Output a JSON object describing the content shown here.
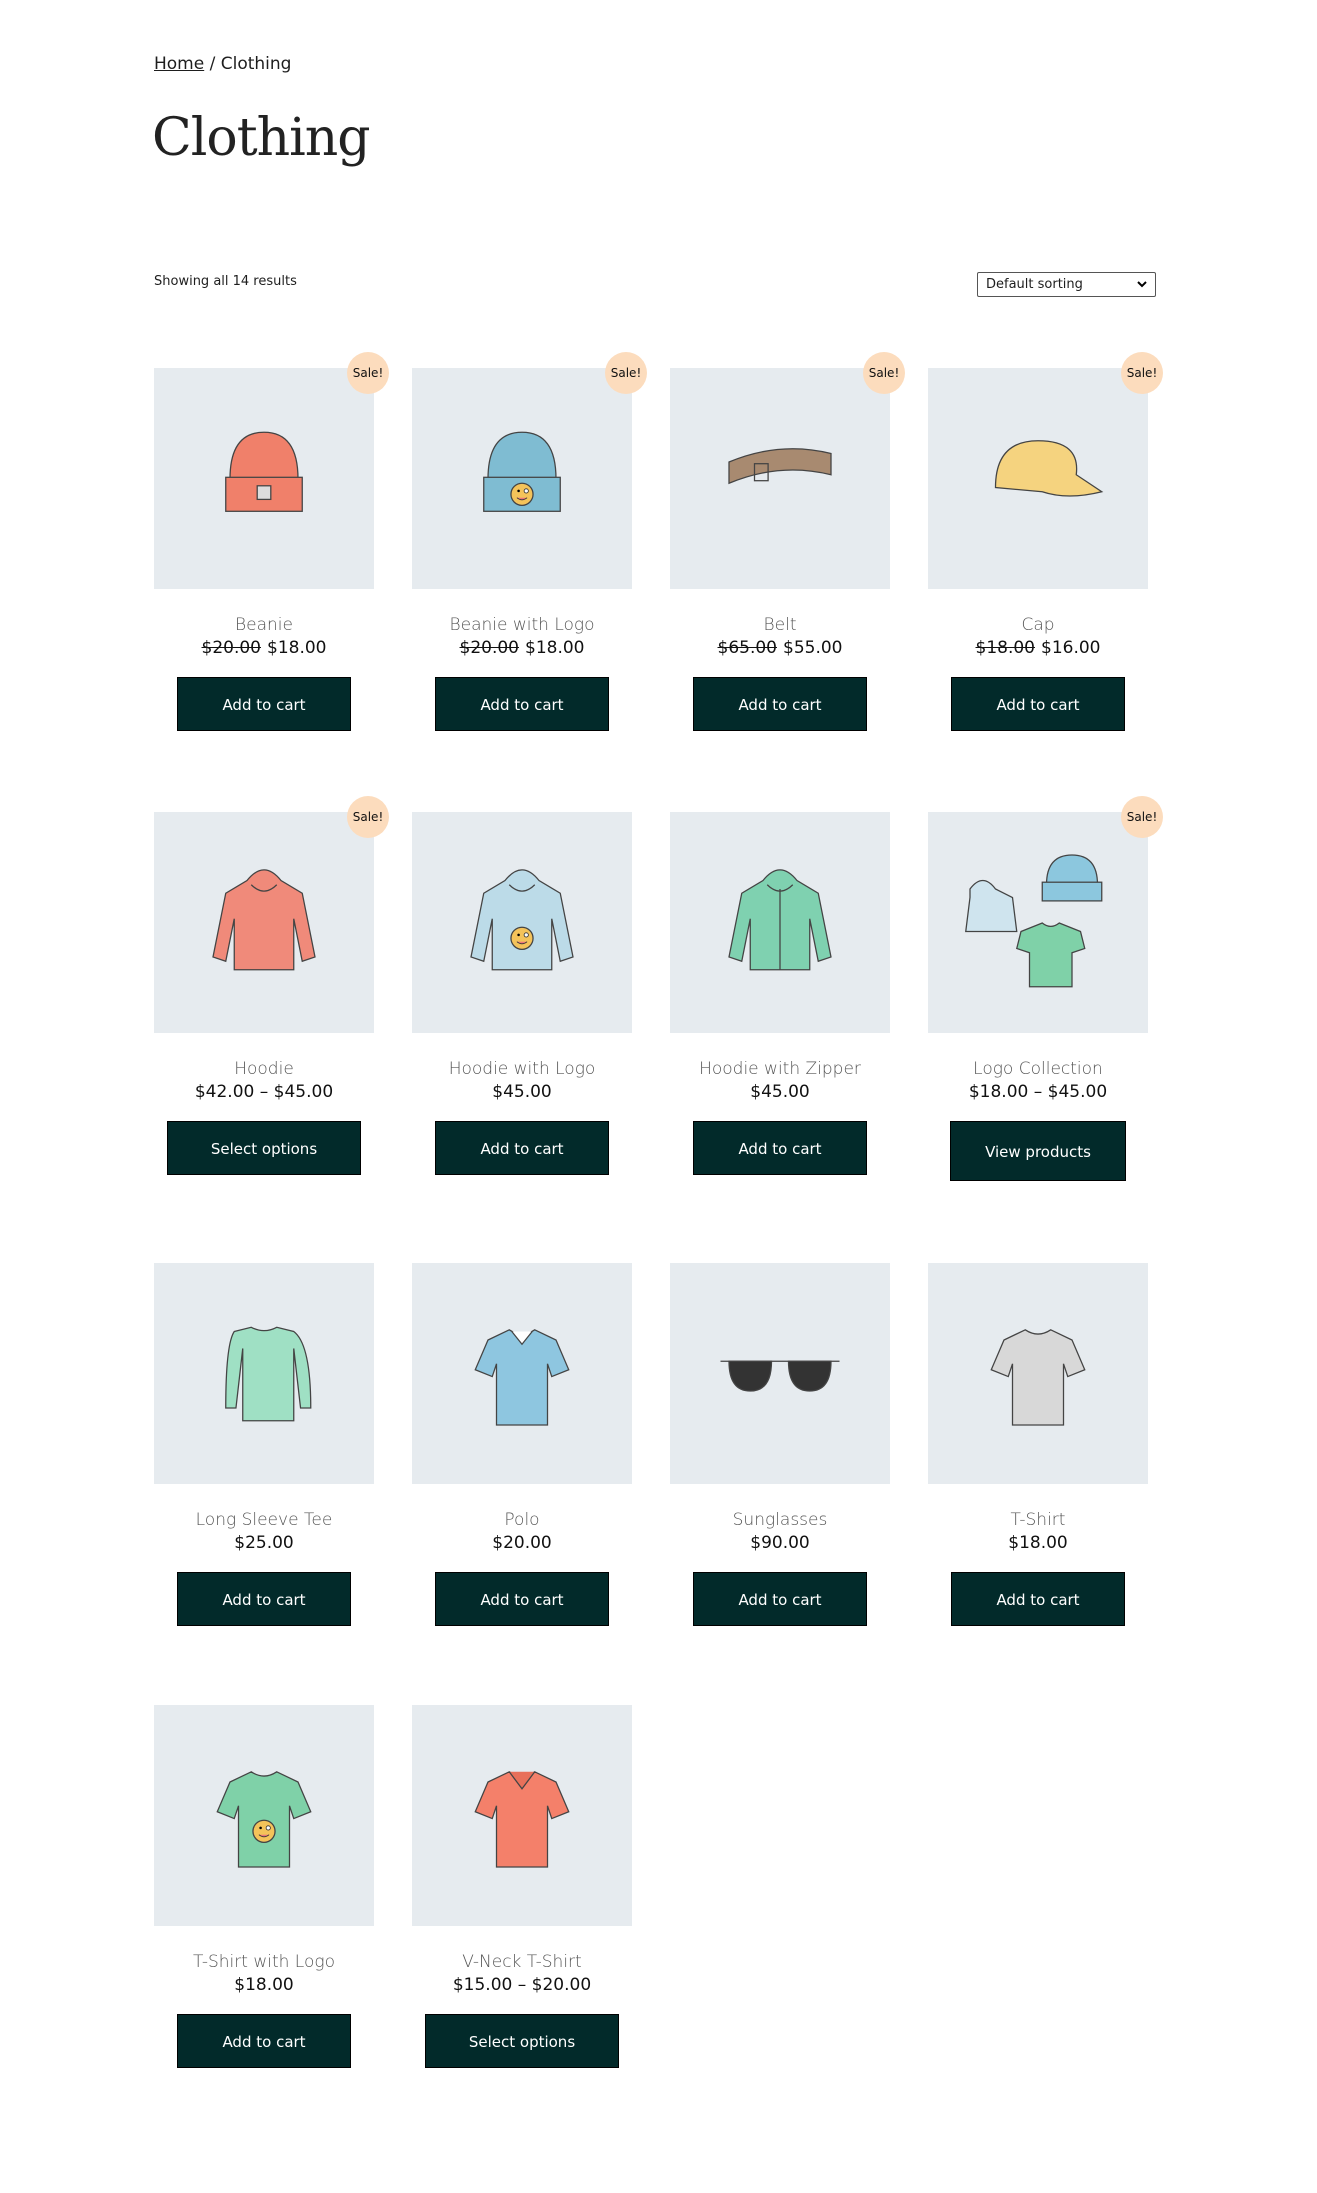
{
  "breadcrumb": {
    "home": "Home",
    "separator": " / ",
    "current": "Clothing"
  },
  "page_title": "Clothing",
  "result_count": "Showing all 14 results",
  "sorting": {
    "selected": "Default sorting",
    "icon": "chevron-down-icon"
  },
  "sale_label": "Sale!",
  "colors": {
    "button": "#022a2a",
    "badge": "#fcdcbd",
    "image_bg": "#e6ebef"
  },
  "products": [
    {
      "name": "Beanie",
      "regular_price": "$20.00",
      "price": "$18.00",
      "sale": true,
      "button": "Add to cart",
      "kind": "beanie",
      "color": "#f0806a"
    },
    {
      "name": "Beanie with Logo",
      "regular_price": "$20.00",
      "price": "$18.00",
      "sale": true,
      "button": "Add to cart",
      "kind": "beanie-logo",
      "color": "#7fbcd2"
    },
    {
      "name": "Belt",
      "regular_price": "$65.00",
      "price": "$55.00",
      "sale": true,
      "button": "Add to cart",
      "kind": "belt",
      "color": "#a88a70"
    },
    {
      "name": "Cap",
      "regular_price": "$18.00",
      "price": "$16.00",
      "sale": true,
      "button": "Add to cart",
      "kind": "cap",
      "color": "#f5d37f"
    },
    {
      "name": "Hoodie",
      "regular_price": "",
      "price": "$42.00 – $45.00",
      "sale": true,
      "button": "Select options",
      "kind": "hoodie",
      "color": "#f08a7a"
    },
    {
      "name": "Hoodie with Logo",
      "regular_price": "",
      "price": "$45.00",
      "sale": false,
      "button": "Add to cart",
      "kind": "hoodie-logo",
      "color": "#bcdbe8"
    },
    {
      "name": "Hoodie with Zipper",
      "regular_price": "",
      "price": "$45.00",
      "sale": false,
      "button": "Add to cart",
      "kind": "hoodie-zip",
      "color": "#7fd1b0"
    },
    {
      "name": "Logo Collection",
      "regular_price": "",
      "price": "$18.00 – $45.00",
      "sale": true,
      "button": "View products",
      "kind": "collection",
      "color": "#8cc7de"
    },
    {
      "name": "Long Sleeve Tee",
      "regular_price": "",
      "price": "$25.00",
      "sale": false,
      "button": "Add to cart",
      "kind": "longsleeve",
      "color": "#9fe0c4"
    },
    {
      "name": "Polo",
      "regular_price": "",
      "price": "$20.00",
      "sale": false,
      "button": "Add to cart",
      "kind": "polo",
      "color": "#8ec6e0"
    },
    {
      "name": "Sunglasses",
      "regular_price": "",
      "price": "$90.00",
      "sale": false,
      "button": "Add to cart",
      "kind": "sunglasses",
      "color": "#333333"
    },
    {
      "name": "T-Shirt",
      "regular_price": "",
      "price": "$18.00",
      "sale": false,
      "button": "Add to cart",
      "kind": "tshirt",
      "color": "#d8d8d8"
    },
    {
      "name": "T-Shirt with Logo",
      "regular_price": "",
      "price": "$18.00",
      "sale": false,
      "button": "Add to cart",
      "kind": "tshirt-logo",
      "color": "#7fd1a8"
    },
    {
      "name": "V-Neck T-Shirt",
      "regular_price": "",
      "price": "$15.00 – $20.00",
      "sale": false,
      "button": "Select options",
      "kind": "vneck",
      "color": "#f4806a"
    }
  ]
}
